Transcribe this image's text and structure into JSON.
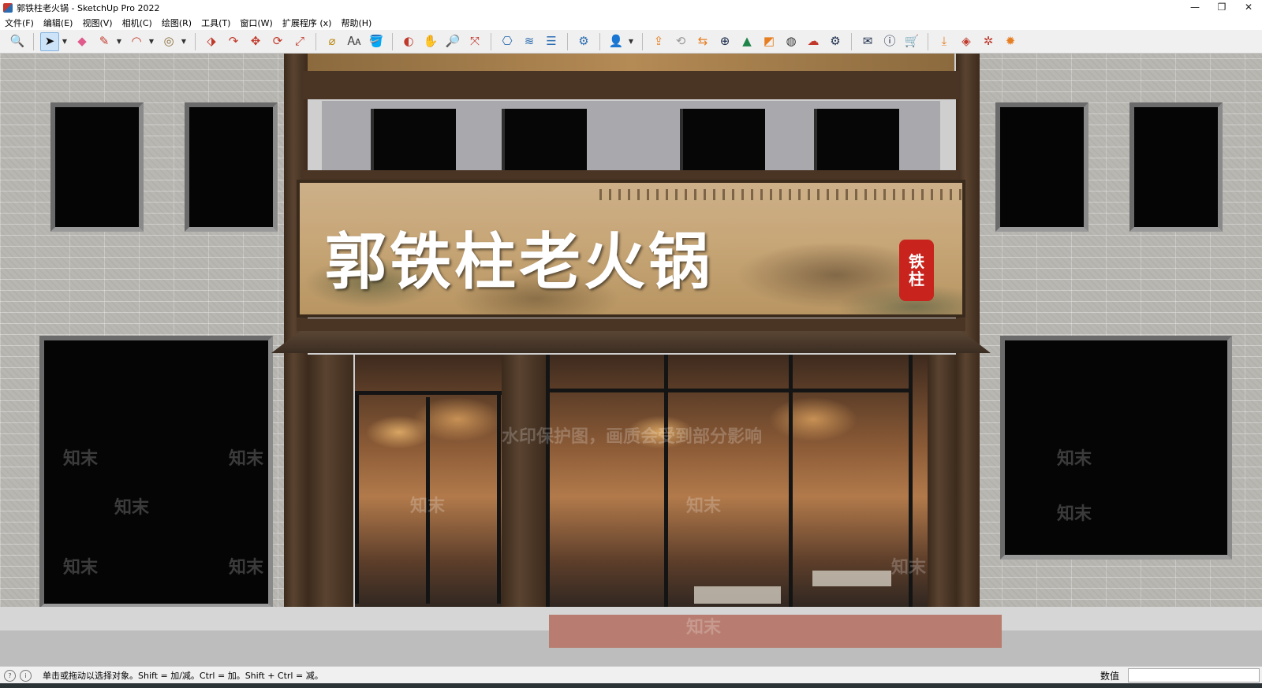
{
  "window": {
    "title": "郭铁柱老火锅 - SketchUp Pro 2022",
    "controls": {
      "minimize": "—",
      "restore": "❐",
      "close": "✕"
    }
  },
  "menu": {
    "items": [
      "文件(F)",
      "编辑(E)",
      "视图(V)",
      "相机(C)",
      "绘图(R)",
      "工具(T)",
      "窗口(W)",
      "扩展程序 (x)",
      "帮助(H)"
    ]
  },
  "toolbar": {
    "active_tool": "select-tool"
  },
  "scene": {
    "sign_text": "郭铁柱老火锅",
    "seal_top": "铁",
    "seal_bottom": "柱",
    "watermark_brand": "知末",
    "watermark_notice": "水印保护图，画质会受到部分影响"
  },
  "status": {
    "message": "单击或拖动以选择对象。Shift = 加/减。Ctrl = 加。Shift + Ctrl = 减。",
    "measurements_label": "数值",
    "measurements_value": ""
  }
}
